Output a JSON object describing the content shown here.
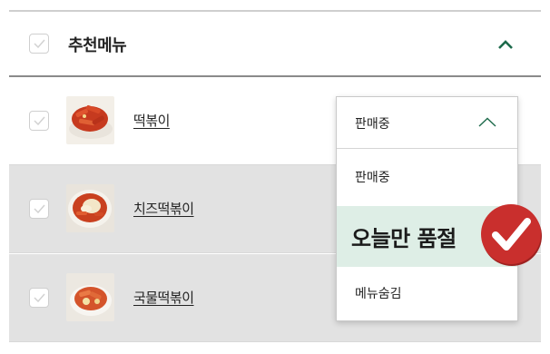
{
  "section": {
    "title": "추천메뉴"
  },
  "menu_items": [
    {
      "name": "떡볶이"
    },
    {
      "name": "치즈떡볶이"
    },
    {
      "name": "국물떡볶이"
    }
  ],
  "status_dropdown": {
    "selected": "판매중",
    "options": [
      "판매중",
      "오늘만 품절",
      "메뉴숨김"
    ],
    "highlighted": "오늘만 품절"
  },
  "colors": {
    "accent_green": "#1d6a4b",
    "highlight_bg": "#deeee6",
    "badge_red": "#c92f2d",
    "disabled_row_bg": "#e2e2e2"
  },
  "icons": {
    "header_toggle": "chevron-up-icon",
    "dropdown_toggle": "chevron-up-icon",
    "badge": "checkmark-icon"
  }
}
